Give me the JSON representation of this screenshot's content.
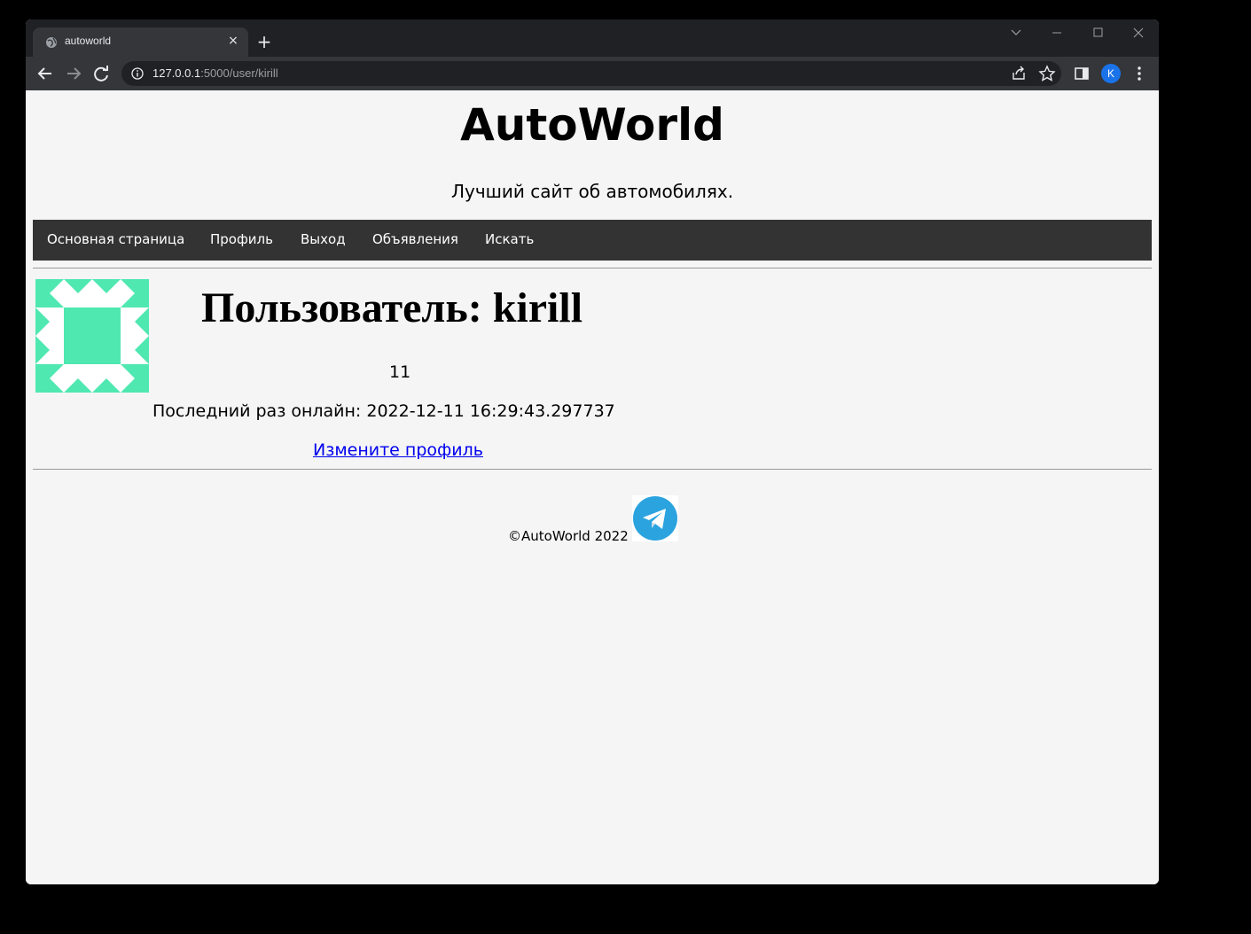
{
  "browser": {
    "tab_title": "autoworld",
    "tab_close": "×",
    "new_tab": "+",
    "url_host": "127.0.0.1",
    "url_rest": ":5000/user/kirill",
    "profile_initial": "K"
  },
  "header": {
    "site_title": "AutoWorld",
    "tagline": "Лучший сайт об автомобилях."
  },
  "nav": {
    "items": [
      "Основная страница",
      "Профиль",
      "Выход",
      "Объявления",
      "Искать"
    ]
  },
  "profile": {
    "heading": "Пользователь: kirill",
    "count": "11",
    "last_seen": "Последний раз онлайн: 2022-12-11 16:29:43.297737",
    "edit_link": "Измените профиль",
    "identicon_color": "#4fe8b0"
  },
  "footer": {
    "copyright": "©AutoWorld 2022"
  },
  "colors": {
    "navbar_bg": "#333333",
    "page_bg": "#f5f5f5",
    "link": "#0000ee",
    "telegram": "#2aa3df"
  }
}
